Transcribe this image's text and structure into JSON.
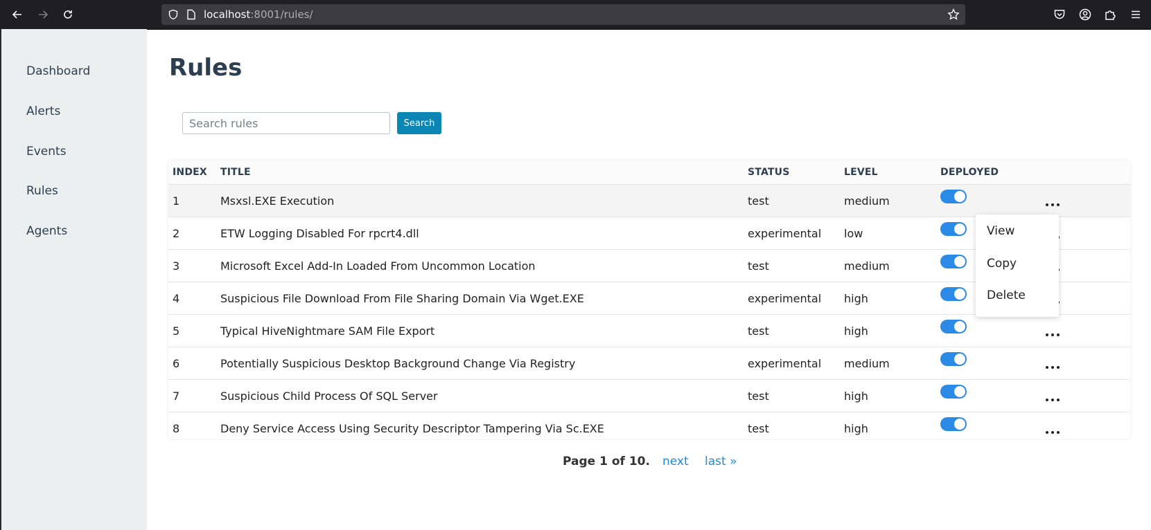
{
  "browser": {
    "url_host": "localhost",
    "url_rest": ":8001/rules/"
  },
  "sidebar": {
    "items": [
      {
        "label": "Dashboard"
      },
      {
        "label": "Alerts"
      },
      {
        "label": "Events"
      },
      {
        "label": "Rules"
      },
      {
        "label": "Agents"
      }
    ]
  },
  "page": {
    "title": "Rules"
  },
  "search": {
    "placeholder": "Search rules",
    "button_label": "Search"
  },
  "table": {
    "columns": [
      "INDEX",
      "TITLE",
      "STATUS",
      "LEVEL",
      "DEPLOYED"
    ],
    "rows": [
      {
        "index": "1",
        "title": "Msxsl.EXE Execution",
        "status": "test",
        "level": "medium",
        "deployed": true
      },
      {
        "index": "2",
        "title": "ETW Logging Disabled For rpcrt4.dll",
        "status": "experimental",
        "level": "low",
        "deployed": true
      },
      {
        "index": "3",
        "title": "Microsoft Excel Add-In Loaded From Uncommon Location",
        "status": "test",
        "level": "medium",
        "deployed": true
      },
      {
        "index": "4",
        "title": "Suspicious File Download From File Sharing Domain Via Wget.EXE",
        "status": "experimental",
        "level": "high",
        "deployed": true
      },
      {
        "index": "5",
        "title": "Typical HiveNightmare SAM File Export",
        "status": "test",
        "level": "high",
        "deployed": true
      },
      {
        "index": "6",
        "title": "Potentially Suspicious Desktop Background Change Via Registry",
        "status": "experimental",
        "level": "medium",
        "deployed": true
      },
      {
        "index": "7",
        "title": "Suspicious Child Process Of SQL Server",
        "status": "test",
        "level": "high",
        "deployed": true
      },
      {
        "index": "8",
        "title": "Deny Service Access Using Security Descriptor Tampering Via Sc.EXE",
        "status": "test",
        "level": "high",
        "deployed": true
      }
    ]
  },
  "context_menu": {
    "items": [
      "View",
      "Copy",
      "Delete"
    ]
  },
  "pagination": {
    "current": "Page 1 of 10.",
    "next": "next",
    "last": "last »"
  },
  "colors": {
    "medium": "#f0a30a",
    "low": "#1f8b1f",
    "high": "#e01010",
    "toggle_on": "#2b8ae6",
    "search_button": "#0a85b4",
    "link": "#1c8ad8"
  }
}
